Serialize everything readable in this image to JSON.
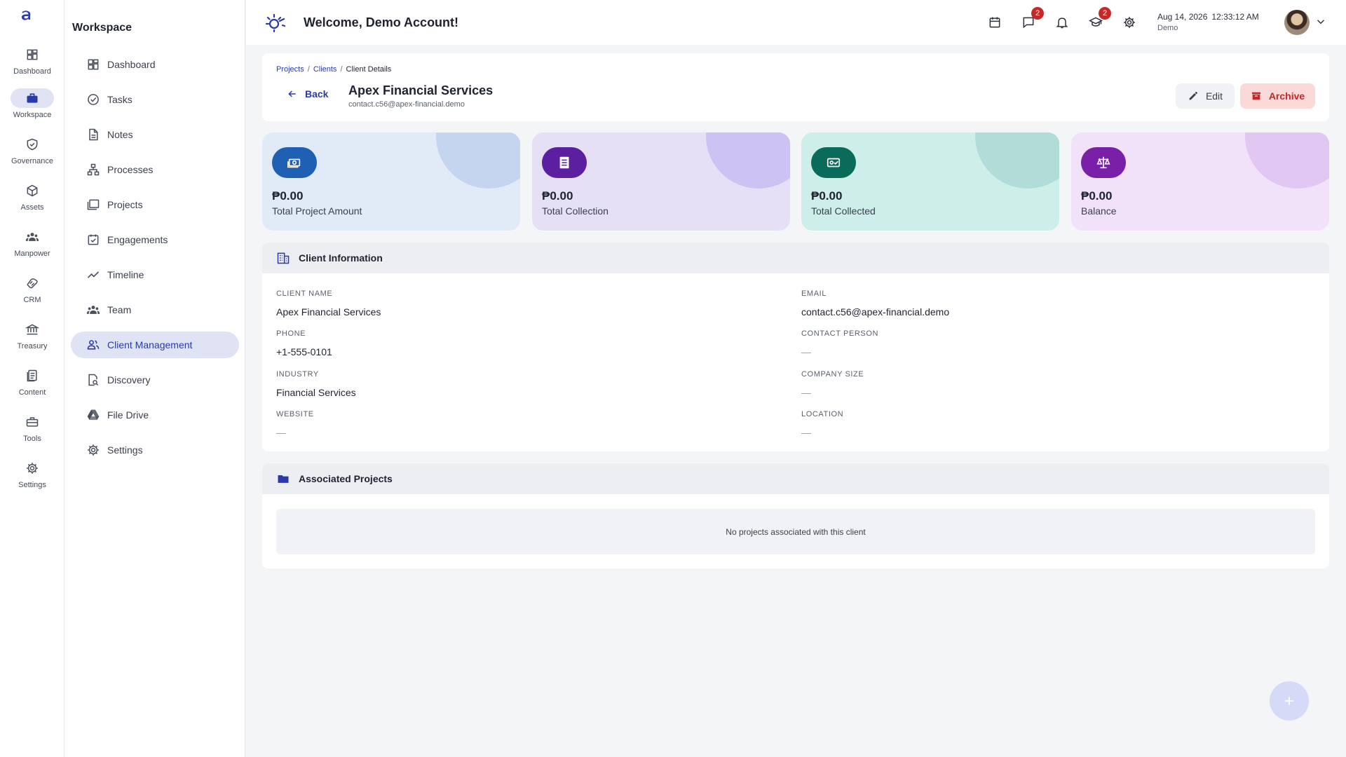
{
  "rail": {
    "items": [
      {
        "label": "Dashboard",
        "icon": "dashboard-icon"
      },
      {
        "label": "Workspace",
        "icon": "briefcase-icon",
        "active": true
      },
      {
        "label": "Governance",
        "icon": "shield-icon"
      },
      {
        "label": "Assets",
        "icon": "cube-icon"
      },
      {
        "label": "Manpower",
        "icon": "people-icon"
      },
      {
        "label": "CRM",
        "icon": "handshake-icon"
      },
      {
        "label": "Treasury",
        "icon": "bank-icon"
      },
      {
        "label": "Content",
        "icon": "document-icon"
      },
      {
        "label": "Tools",
        "icon": "toolbox-icon"
      },
      {
        "label": "Settings",
        "icon": "gear-icon"
      }
    ]
  },
  "sidebar": {
    "title": "Workspace",
    "items": [
      {
        "label": "Dashboard",
        "icon": "dashboard-icon"
      },
      {
        "label": "Tasks",
        "icon": "check-circle-icon"
      },
      {
        "label": "Notes",
        "icon": "note-icon"
      },
      {
        "label": "Processes",
        "icon": "hierarchy-icon"
      },
      {
        "label": "Projects",
        "icon": "folders-icon"
      },
      {
        "label": "Engagements",
        "icon": "calendar-check-icon"
      },
      {
        "label": "Timeline",
        "icon": "trend-icon"
      },
      {
        "label": "Team",
        "icon": "people-icon"
      },
      {
        "label": "Client Management",
        "icon": "client-icon",
        "active": true
      },
      {
        "label": "Discovery",
        "icon": "search-doc-icon"
      },
      {
        "label": "File Drive",
        "icon": "drive-icon"
      },
      {
        "label": "Settings",
        "icon": "gear-icon"
      }
    ]
  },
  "header": {
    "welcome": "Welcome, Demo Account!",
    "date": "Aug 14, 2026",
    "time": "12:33:12 AM",
    "sub": "Demo",
    "messages_badge": "2",
    "learning_badge": "2"
  },
  "detail": {
    "breadcrumbs": [
      "Projects",
      "Clients",
      "Client Details"
    ],
    "back_label": "Back",
    "client_name": "Apex Financial Services",
    "client_email": "contact.c56@apex-financial.demo",
    "edit_label": "Edit",
    "archive_label": "Archive"
  },
  "stats": [
    {
      "amount": "₱0.00",
      "label": "Total Project Amount",
      "bg": "#e1eaf7",
      "deco": "#c5d4ef",
      "icon_bg": "#1f5fb4"
    },
    {
      "amount": "₱0.00",
      "label": "Total Collection",
      "bg": "#e5e0f6",
      "deco": "#cdc3f2",
      "icon_bg": "#5b1fa0"
    },
    {
      "amount": "₱0.00",
      "label": "Total Collected",
      "bg": "#cdeee9",
      "deco": "#b2dcd8",
      "icon_bg": "#0b6b5a"
    },
    {
      "amount": "₱0.00",
      "label": "Balance",
      "bg": "#f1e2f9",
      "deco": "#e0c8f3",
      "icon_bg": "#7a1fa8"
    }
  ],
  "client_info": {
    "title": "Client Information",
    "fields": [
      {
        "key": "CLIENT NAME",
        "value": "Apex Financial Services"
      },
      {
        "key": "EMAIL",
        "value": "contact.c56@apex-financial.demo"
      },
      {
        "key": "PHONE",
        "value": "+1-555-0101"
      },
      {
        "key": "CONTACT PERSON",
        "value": "—"
      },
      {
        "key": "INDUSTRY",
        "value": "Financial Services"
      },
      {
        "key": "COMPANY SIZE",
        "value": "—"
      },
      {
        "key": "WEBSITE",
        "value": "—"
      },
      {
        "key": "LOCATION",
        "value": "—"
      }
    ]
  },
  "projects": {
    "title": "Associated Projects",
    "empty": "No projects associated with this client"
  }
}
